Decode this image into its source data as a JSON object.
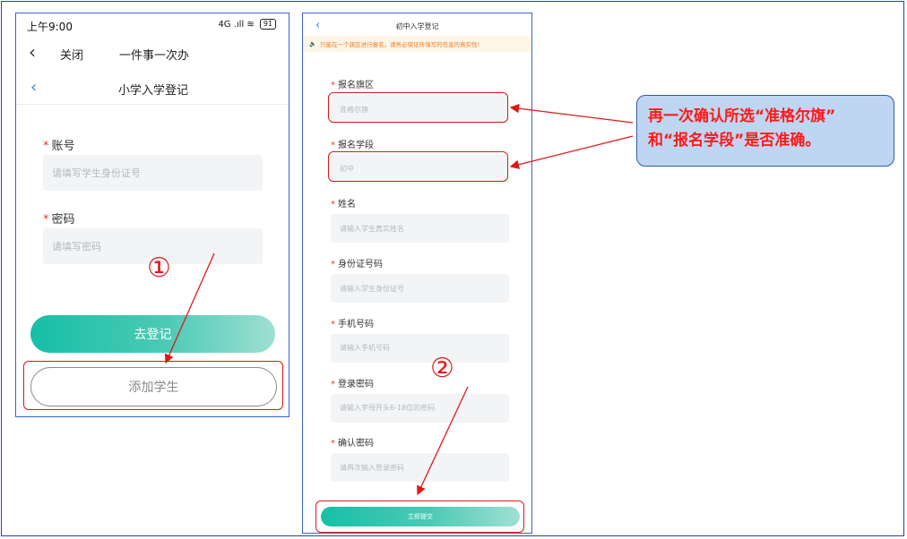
{
  "left_screen": {
    "status_time": "上午9:00",
    "status_icons": "4G .ıll ≋",
    "battery": "91",
    "back_label": "关闭",
    "top_title": "一件事一次办",
    "page_title": "小学入学登记",
    "account_label": "账号",
    "account_placeholder": "请填写学生身份证号",
    "password_label": "密码",
    "password_placeholder": "请填写密码",
    "primary_button": "去登记",
    "secondary_button": "添加学生"
  },
  "right_screen": {
    "title": "初中入学登记",
    "notice": "只能在一个旗区进行报名。请务必保证所填写的信息的真实性!",
    "fields": [
      {
        "label": "报名旗区",
        "value": "准格尔旗"
      },
      {
        "label": "报名学段",
        "value": "初中"
      },
      {
        "label": "姓名",
        "value": "请输入学生真实姓名"
      },
      {
        "label": "身份证号码",
        "value": "请输入学生身份证号"
      },
      {
        "label": "手机号码",
        "value": "请输入手机号码"
      },
      {
        "label": "登录密码",
        "value": "请输入字母开头6-18位的密码"
      },
      {
        "label": "确认密码",
        "value": "请再次输入登录密码"
      }
    ],
    "submit_button": "立即提交"
  },
  "annotations": {
    "step1": "①",
    "step2": "②",
    "callout_line1": "再一次确认所选“准格尔旗”",
    "callout_line2": "和“报名学段”是否准确。"
  },
  "colors": {
    "accent": "#16bfa7",
    "required": "#e23b3b",
    "highlight": "#e01818",
    "callout_bg": "#bfd6f2",
    "callout_text": "#ff1a1a",
    "notice_text": "#f07b22"
  }
}
